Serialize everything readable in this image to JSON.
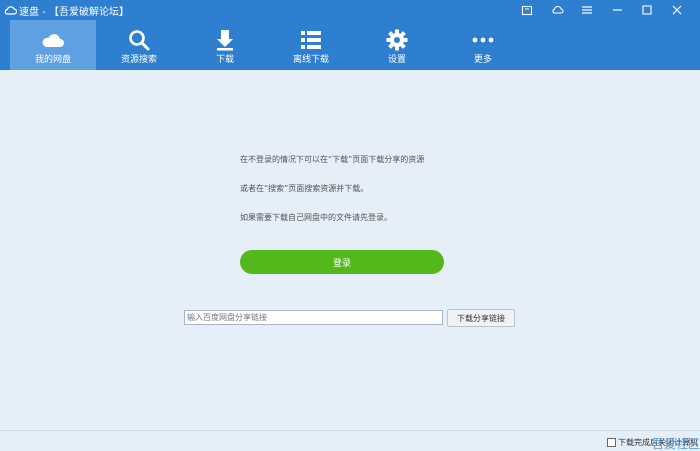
{
  "window": {
    "title": "速盘 - 【吾爱破解论坛】",
    "controls": [
      "shirt-icon",
      "cloud-icon",
      "menu-icon",
      "minimize-icon",
      "maximize-icon",
      "close-icon"
    ]
  },
  "toolbar": {
    "items": [
      {
        "label": "我的网盘",
        "icon": "cloud-icon",
        "active": true
      },
      {
        "label": "资源搜索",
        "icon": "search-icon",
        "active": false
      },
      {
        "label": "下载",
        "icon": "download-icon",
        "active": false
      },
      {
        "label": "离线下载",
        "icon": "list-icon",
        "active": false
      },
      {
        "label": "设置",
        "icon": "gear-icon",
        "active": false
      },
      {
        "label": "更多",
        "icon": "more-icon",
        "active": false
      }
    ]
  },
  "main": {
    "messages": [
      "在不登录的情况下可以在“下载”页面下载分享的资源",
      "或者在“搜索”页面搜索资源并下载。",
      "如果需要下载自己网盘中的文件请先登录。"
    ],
    "login_label": "登录",
    "link_input_placeholder": "输入百度网盘分享链接",
    "link_input_value": "",
    "link_button_label": "下载分享链接"
  },
  "statusbar": {
    "shutdown_label": "下载完成后关闭计算机",
    "shutdown_checked": false
  },
  "watermark": "吾爱社区",
  "colors": {
    "header": "#2f7fd0",
    "active_tab": "#5ea0e2",
    "background": "#e6eef7",
    "login_button": "#52b81c"
  }
}
